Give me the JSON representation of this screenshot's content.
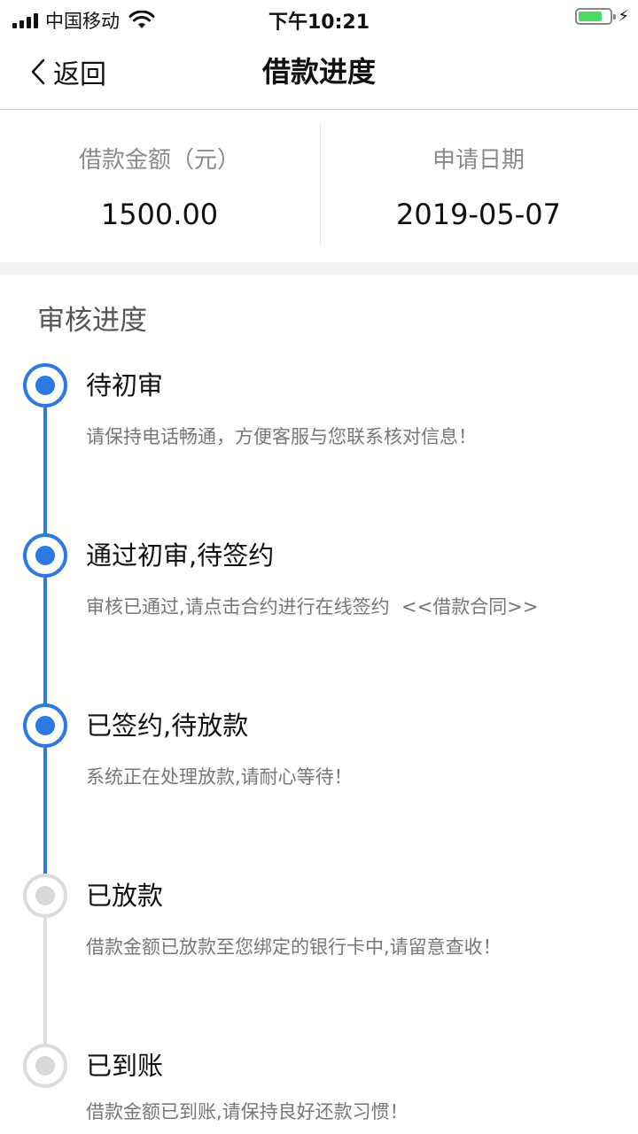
{
  "status_bar": {
    "carrier": "中国移动",
    "time": "下午10:21",
    "icons": [
      "signal-icon",
      "wifi-icon",
      "battery-icon",
      "charging-bolt-icon"
    ]
  },
  "nav": {
    "back_label": "返回",
    "title": "借款进度"
  },
  "summary": {
    "amount_label": "借款金额（元）",
    "amount_value": "1500.00",
    "date_label": "申请日期",
    "date_value": "2019-05-07"
  },
  "progress": {
    "title": "审核进度",
    "accent_color": "#2a7ae2",
    "inactive_color": "#d8d8d8",
    "steps": [
      {
        "title": "待初审",
        "desc": "请保持电话畅通，方便客服与您联系核对信息！",
        "status": "done"
      },
      {
        "title": "通过初审,待签约",
        "desc": "审核已通过,请点击合约进行在线签约",
        "link": "<<借款合同>>",
        "status": "done"
      },
      {
        "title": "已签约,待放款",
        "desc": "系统正在处理放款,请耐心等待！",
        "status": "done"
      },
      {
        "title": "已放款",
        "desc": "借款金额已放款至您绑定的银行卡中,请留意查收！",
        "status": "pending"
      },
      {
        "title": "已到账",
        "desc": "借款金额已到账,请保持良好还款习惯！",
        "status": "pending"
      }
    ]
  }
}
